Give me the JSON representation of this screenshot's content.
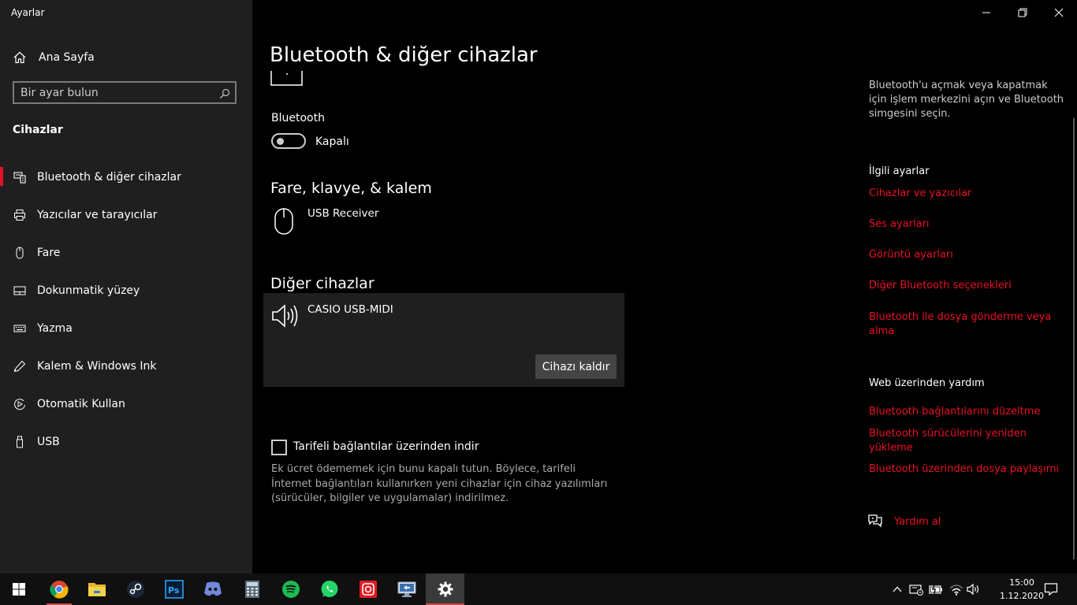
{
  "window": {
    "title": "Ayarlar"
  },
  "sidebar": {
    "home_label": "Ana Sayfa",
    "search_placeholder": "Bir ayar bulun",
    "section_heading": "Cihazlar",
    "items": [
      {
        "label": "Bluetooth & diğer cihazlar",
        "icon": "bluetooth-devices-icon",
        "active": true
      },
      {
        "label": "Yazıcılar ve tarayıcılar",
        "icon": "printer-icon"
      },
      {
        "label": "Fare",
        "icon": "mouse-icon"
      },
      {
        "label": "Dokunmatik yüzey",
        "icon": "touchpad-icon"
      },
      {
        "label": "Yazma",
        "icon": "keyboard-icon"
      },
      {
        "label": "Kalem & Windows Ink",
        "icon": "pen-icon"
      },
      {
        "label": "Otomatik Kullan",
        "icon": "autoplay-icon"
      },
      {
        "label": "USB",
        "icon": "usb-icon"
      }
    ]
  },
  "main": {
    "title": "Bluetooth & diğer cihazlar",
    "bluetooth_label": "Bluetooth",
    "bluetooth_state": "Kapalı",
    "bluetooth_on": false,
    "mouse_section": {
      "heading": "Fare, klavye, & kalem",
      "devices": [
        {
          "name": "USB Receiver",
          "icon": "mouse-icon"
        }
      ]
    },
    "other_section": {
      "heading": "Diğer cihazlar",
      "devices": [
        {
          "name": "CASIO USB-MIDI",
          "icon": "speaker-icon",
          "button": "Cihazı kaldır"
        }
      ]
    },
    "metered": {
      "label": "Tarifeli bağlantılar üzerinden indir",
      "checked": false,
      "description": "Ek ücret ödememek için bunu kapalı tutun. Böylece, tarifeli İnternet bağlantıları kullanırken yeni cihazlar için cihaz yazılımları (sürücüler, bilgiler ve uygulamalar) indirilmez."
    }
  },
  "right": {
    "description": "Bluetooth'u açmak veya kapatmak için işlem merkezini açın ve Bluetooth simgesini seçin.",
    "related_heading": "İlgili ayarlar",
    "related_links": [
      "Cihazlar ve yazıcılar",
      "Ses ayarları",
      "Görüntü ayarları",
      "Diğer Bluetooth seçenekleri",
      "Bluetooth ile dosya gönderme veya alma"
    ],
    "web_heading": "Web üzerinden yardım",
    "web_links": [
      "Bluetooth bağlantılarını düzeltme",
      "Bluetooth sürücülerini yeniden yükleme",
      "Bluetooth üzerinden dosya paylaşımı"
    ],
    "help_label": "Yardım al"
  },
  "colors": {
    "accent": "#e81123",
    "sidebar_bg": "#1f1f1f",
    "content_bg": "#000000",
    "card_bg": "#1f1f1f",
    "button_bg": "#454545"
  },
  "taskbar": {
    "apps": [
      "chrome-icon",
      "file-explorer-icon",
      "steam-icon",
      "photoshop-icon",
      "discord-icon",
      "calculator-icon",
      "spotify-icon",
      "whatsapp-icon",
      "screen-recorder-icon",
      "remote-desktop-icon",
      "settings-icon"
    ],
    "time": "15:00",
    "date": "1.12.2020"
  }
}
